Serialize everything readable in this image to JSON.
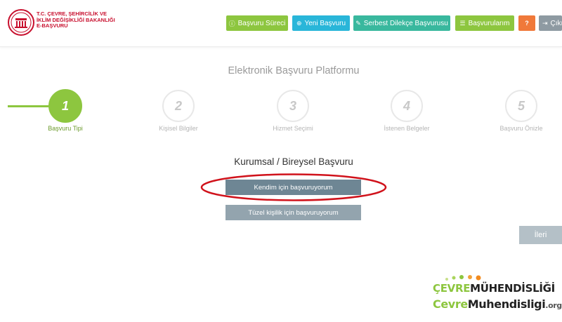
{
  "brand": {
    "line1": "T.C. ÇEVRE, ŞEHİRCİLİK VE",
    "line2": "İKLİM DEĞİŞİKLİĞİ BAKANLIĞI",
    "line3": "E-BAŞVURU"
  },
  "nav": [
    {
      "label": "Başvuru Süreci",
      "icon": "info-icon",
      "glyph": "ⓘ",
      "color": "#8dc63f"
    },
    {
      "label": "Yeni Başvuru",
      "icon": "plus-icon",
      "glyph": "⊕",
      "color": "#29b6d9"
    },
    {
      "label": "Serbest Dilekçe Başvurusu",
      "icon": "pencil-icon",
      "glyph": "✎",
      "color": "#39b89e"
    },
    {
      "label": "Başvurularım",
      "icon": "list-icon",
      "glyph": "☰",
      "color": "#8dc63f"
    },
    {
      "label": "",
      "icon": "question-icon",
      "glyph": "?",
      "color": "#f0793a"
    },
    {
      "label": "Çıkı",
      "icon": "logout-icon",
      "glyph": "⇥",
      "color": "#8e9aa2"
    }
  ],
  "page_title": "Elektronik Başvuru Platformu",
  "steps": [
    {
      "number": "1",
      "label": "Başvuru Tipi",
      "active": true
    },
    {
      "number": "2",
      "label": "Kişisel Bilgiler",
      "active": false
    },
    {
      "number": "3",
      "label": "Hizmet Seçimi",
      "active": false
    },
    {
      "number": "4",
      "label": "İstenen Belgeler",
      "active": false
    },
    {
      "number": "5",
      "label": "Başvuru Önizle",
      "active": false
    }
  ],
  "section_title": "Kurumsal / Bireysel Başvuru",
  "options": {
    "personal": "Kendim için başvuruyorum",
    "corporate": "Tüzel kişilik için başvuruyorum"
  },
  "next_label": "İleri",
  "watermark": {
    "top_a": "ÇEVRE",
    "top_b": "MÜHENDİSLİĞİ",
    "bottom_a": "Cevre",
    "bottom_b": "Muhendisligi",
    "bottom_c": ".org"
  },
  "colors": {
    "accent_green": "#8dc63f",
    "brand_red": "#c8102e",
    "highlight_red": "#d0121b"
  }
}
